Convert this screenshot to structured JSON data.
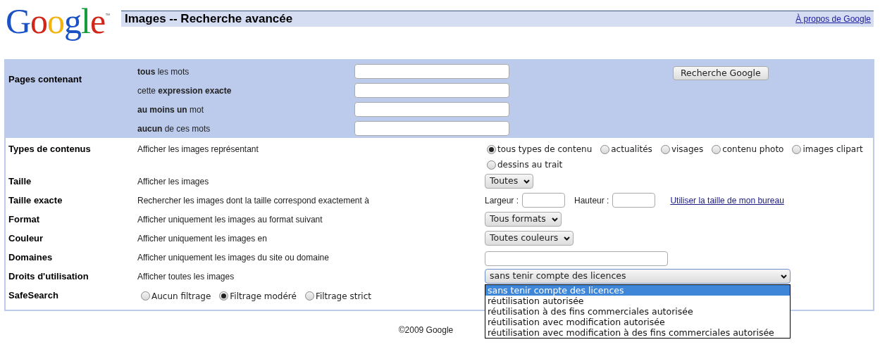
{
  "header": {
    "logo": "Google",
    "logo_mark": "™",
    "title": "Images -- Recherche avancée",
    "about_link": "À propos de Google"
  },
  "pages_section": {
    "label": "Pages contenant",
    "fields": [
      {
        "label": "**tous** les mots"
      },
      {
        "label": "cette **expression exacte**"
      },
      {
        "label": "**au moins un** mot"
      },
      {
        "label": "**aucun** de ces mots"
      }
    ],
    "search_button": "Recherche Google"
  },
  "rows": [
    {
      "kind": "radios",
      "label": "Types de contenus",
      "description": "Afficher les images représentant",
      "options": [
        {
          "label": "tous types de contenu",
          "selected": true
        },
        {
          "label": "actualités",
          "selected": false
        },
        {
          "label": "visages",
          "selected": false
        },
        {
          "label": "contenu photo",
          "selected": false
        },
        {
          "label": "images clipart",
          "selected": false
        },
        {
          "label": "dessins au trait",
          "selected": false
        }
      ]
    },
    {
      "kind": "select",
      "label": "Taille",
      "description": "Afficher les images",
      "value": "Toutes",
      "expanded": false
    },
    {
      "kind": "size",
      "label": "Taille exacte",
      "description": "Rechercher les images dont la taille correspond exactement à",
      "width_label": "Largeur :",
      "height_label": "Hauteur :",
      "link": "Utiliser la taille de mon bureau"
    },
    {
      "kind": "select",
      "label": "Format",
      "description": "Afficher uniquement les images au format suivant",
      "value": "Tous formats",
      "expanded": false
    },
    {
      "kind": "select",
      "label": "Couleur",
      "description": "Afficher uniquement les images en",
      "value": "Toutes couleurs",
      "expanded": false
    },
    {
      "kind": "input",
      "label": "Domaines",
      "description": "Afficher uniquement les images du site ou domaine"
    },
    {
      "kind": "select",
      "label": "Droits d'utilisation",
      "description": "Afficher toutes les images",
      "value": "sans tenir compte des licences",
      "expanded": true,
      "options": [
        {
          "label": "sans tenir compte des licences",
          "selected": true
        },
        {
          "label": "réutilisation autorisée",
          "selected": false
        },
        {
          "label": "réutilisation à des fins commerciales autorisée",
          "selected": false
        },
        {
          "label": "réutilisation avec modification autorisée",
          "selected": false
        },
        {
          "label": "réutilisation avec modification à des fins commerciales autorisée",
          "selected": false
        }
      ]
    },
    {
      "kind": "inline_radios",
      "label": "SafeSearch",
      "options": [
        {
          "label": "Aucun filtrage",
          "selected": false
        },
        {
          "label": "Filtrage modéré",
          "selected": true
        },
        {
          "label": "Filtrage strict",
          "selected": false
        }
      ]
    }
  ],
  "footer": "©2009 Google"
}
